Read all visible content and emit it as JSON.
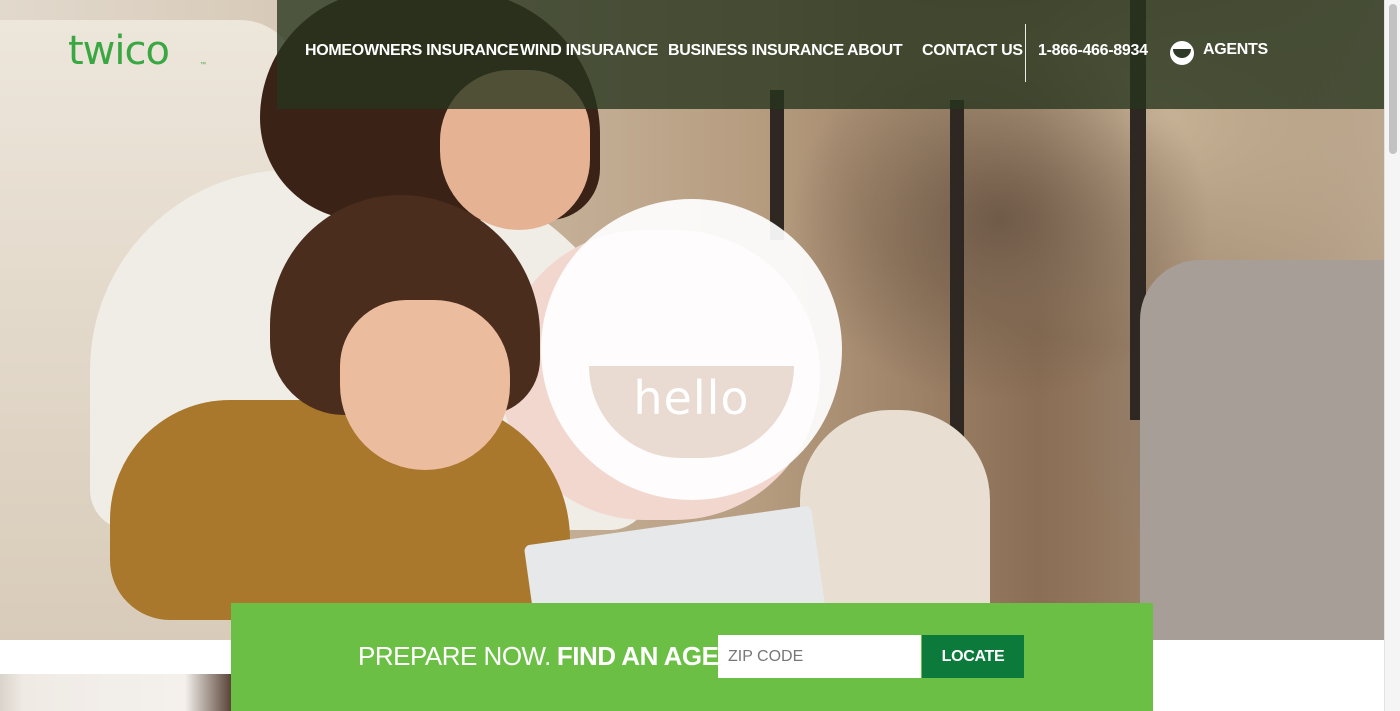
{
  "brand": {
    "logo_text": "twico",
    "logo_tm": "™",
    "color": "#3aa842"
  },
  "nav": {
    "items": [
      {
        "label": "HOMEOWNERS INSURANCE"
      },
      {
        "label": "WIND INSURANCE"
      },
      {
        "label": "BUSINESS INSURANCE"
      },
      {
        "label": "ABOUT"
      },
      {
        "label": "CONTACT US"
      }
    ],
    "phone": "1-866-466-8934",
    "agents_label": "AGENTS",
    "agents_icon": "agent-portal-icon"
  },
  "hero": {
    "badge_text": "hello",
    "image": "family-with-tablet-photo"
  },
  "agent_bar": {
    "prefix": "PREPARE NOW.",
    "emphasis": "FIND AN AGENT",
    "zip_placeholder": "ZIP CODE",
    "zip_value": "",
    "button_label": "LOCATE",
    "bg_color": "#6cbf45",
    "button_color": "#0c7a3a"
  }
}
